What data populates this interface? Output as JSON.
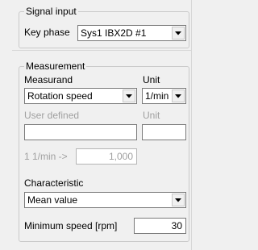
{
  "signal_input": {
    "group_label": "Signal input",
    "key_phase_label": "Key phase",
    "key_phase_value": "Sys1 IBX2D #1"
  },
  "measurement": {
    "group_label": "Measurement",
    "measurand_label": "Measurand",
    "measurand_value": "Rotation speed",
    "unit_label": "Unit",
    "unit_value": "1/min",
    "user_defined_label": "User defined",
    "user_defined_unit_label": "Unit",
    "user_defined_value": "",
    "user_defined_unit_value": "",
    "conversion_label": "1 1/min ->",
    "conversion_value": "1,000",
    "characteristic_label": "Characteristic",
    "characteristic_value": "Mean value",
    "min_speed_label": "Minimum speed [rpm]",
    "min_speed_value": "30"
  },
  "icons": {
    "dropdown": "chevron-down-icon"
  }
}
